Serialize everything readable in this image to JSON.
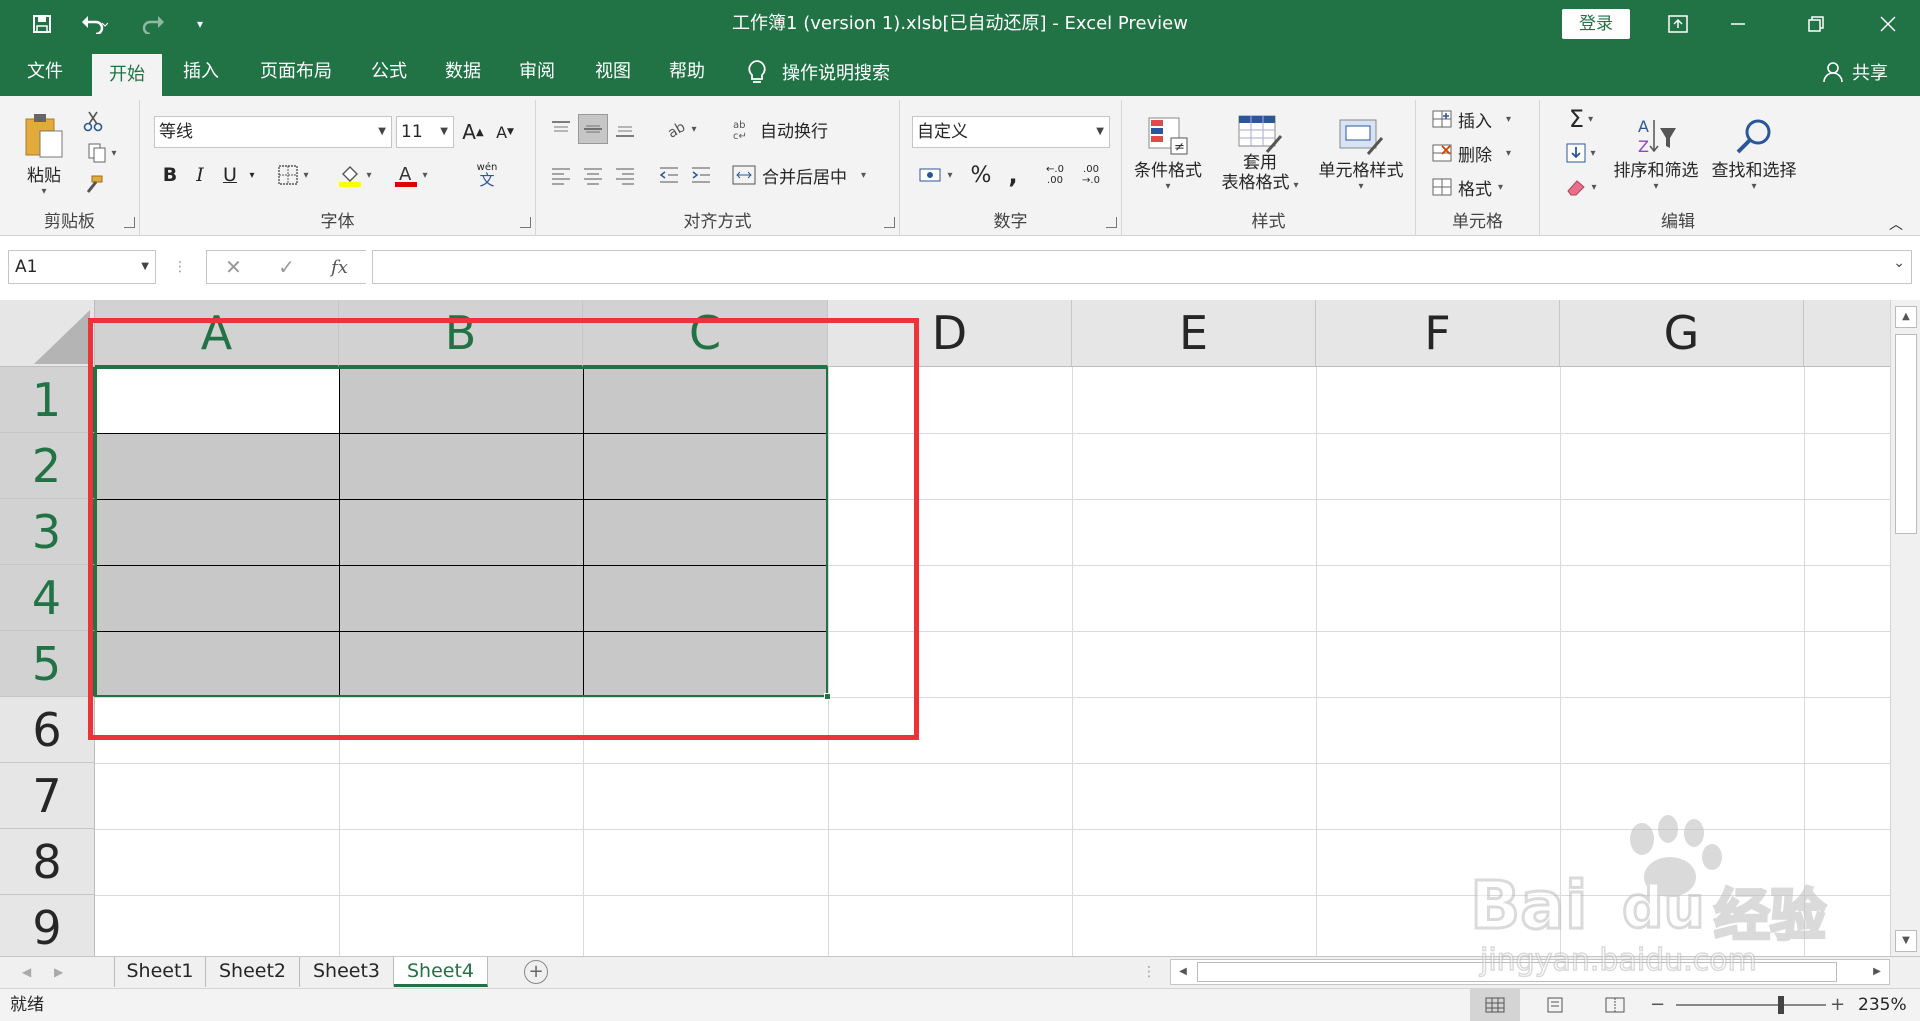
{
  "title_bar": {
    "title": "工作簿1 (version 1).xlsb[已自动还原]  -  Excel Preview",
    "login_label": "登录"
  },
  "tabs": [
    "文件",
    "开始",
    "插入",
    "页面布局",
    "公式",
    "数据",
    "审阅",
    "视图",
    "帮助"
  ],
  "active_tab": "开始",
  "tell_me": "操作说明搜索",
  "share_label": "共享",
  "ribbon": {
    "clipboard": {
      "paste_label": "粘贴",
      "group_label": "剪贴板"
    },
    "font": {
      "font_name": "等线",
      "font_size": "11",
      "bold": "B",
      "italic": "I",
      "underline": "U",
      "wen": "wén",
      "wen_char": "文",
      "grow": "A",
      "shrink": "A",
      "group_label": "字体"
    },
    "alignment": {
      "wrap_label": "自动换行",
      "merge_label": "合并后居中",
      "group_label": "对齐方式"
    },
    "number": {
      "format": "自定义",
      "percent": "%",
      "comma": ",",
      "dec_inc": "←.0 .00",
      "dec_dec": ".00 →.0",
      "group_label": "数字"
    },
    "styles": {
      "cond_format": "条件格式",
      "table_format_1": "套用",
      "table_format_2": "表格格式",
      "cell_styles": "单元格样式",
      "group_label": "样式"
    },
    "cells": {
      "insert": "插入",
      "delete": "删除",
      "format": "格式",
      "group_label": "单元格"
    },
    "editing": {
      "sum": "Σ",
      "sort_filter": "排序和筛选",
      "find_select": "查找和选择",
      "group_label": "编辑"
    }
  },
  "formula_bar": {
    "name_box": "A1",
    "fx": "fx",
    "formula": ""
  },
  "columns": [
    "A",
    "B",
    "C",
    "D",
    "E",
    "F",
    "G"
  ],
  "rows": [
    "1",
    "2",
    "3",
    "4",
    "5",
    "6",
    "7",
    "8",
    "9"
  ],
  "sheets": [
    "Sheet1",
    "Sheet2",
    "Sheet3",
    "Sheet4"
  ],
  "active_sheet": "Sheet4",
  "status": {
    "ready": "就绪",
    "zoom": "235%"
  },
  "watermark": {
    "brand": "Bai",
    "brand2": "du",
    "cn": "经验",
    "url": "jingyan.baidu.com"
  },
  "colors": {
    "accent": "#217346",
    "highlight_box": "#ee3338",
    "selection_fill": "#c8c8c8"
  }
}
